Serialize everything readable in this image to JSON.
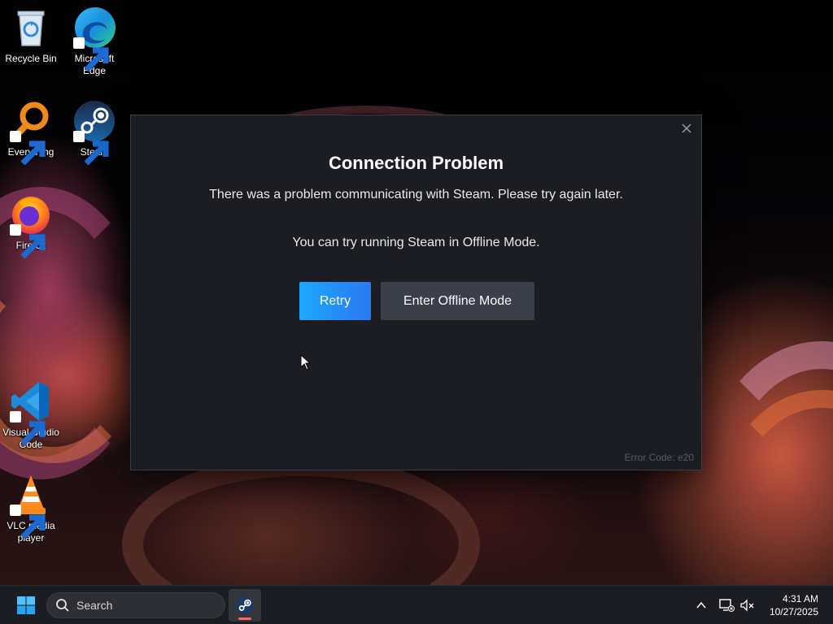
{
  "desktop": {
    "icons": [
      {
        "label": "Recycle Bin",
        "icon": "recycle-bin-icon"
      },
      {
        "label": "Microsoft Edge",
        "icon": "edge-icon"
      },
      {
        "label": "Everything",
        "icon": "everything-search-icon"
      },
      {
        "label": "Steam",
        "icon": "steam-icon"
      },
      {
        "label": "Firefox",
        "icon": "firefox-icon"
      },
      {
        "label": "Visual Studio Code",
        "icon": "vscode-icon"
      },
      {
        "label": "VLC media player",
        "icon": "vlc-icon"
      }
    ]
  },
  "dialog": {
    "title": "Connection Problem",
    "message": "There was a problem communicating with Steam. Please try again later.",
    "offline_hint": "You can try running Steam in Offline Mode.",
    "retry_label": "Retry",
    "offline_label": "Enter Offline Mode",
    "error_code": "Error Code: e20"
  },
  "taskbar": {
    "search_placeholder": "Search",
    "time": "4:31 AM",
    "date": "10/27/2025"
  },
  "colors": {
    "dialog_bg": "#1b1d22",
    "retry_start": "#1ba8ff",
    "retry_end": "#2b79f0",
    "offline_btn": "#3a3f4a",
    "taskbar_bg": "#1c1d22"
  }
}
